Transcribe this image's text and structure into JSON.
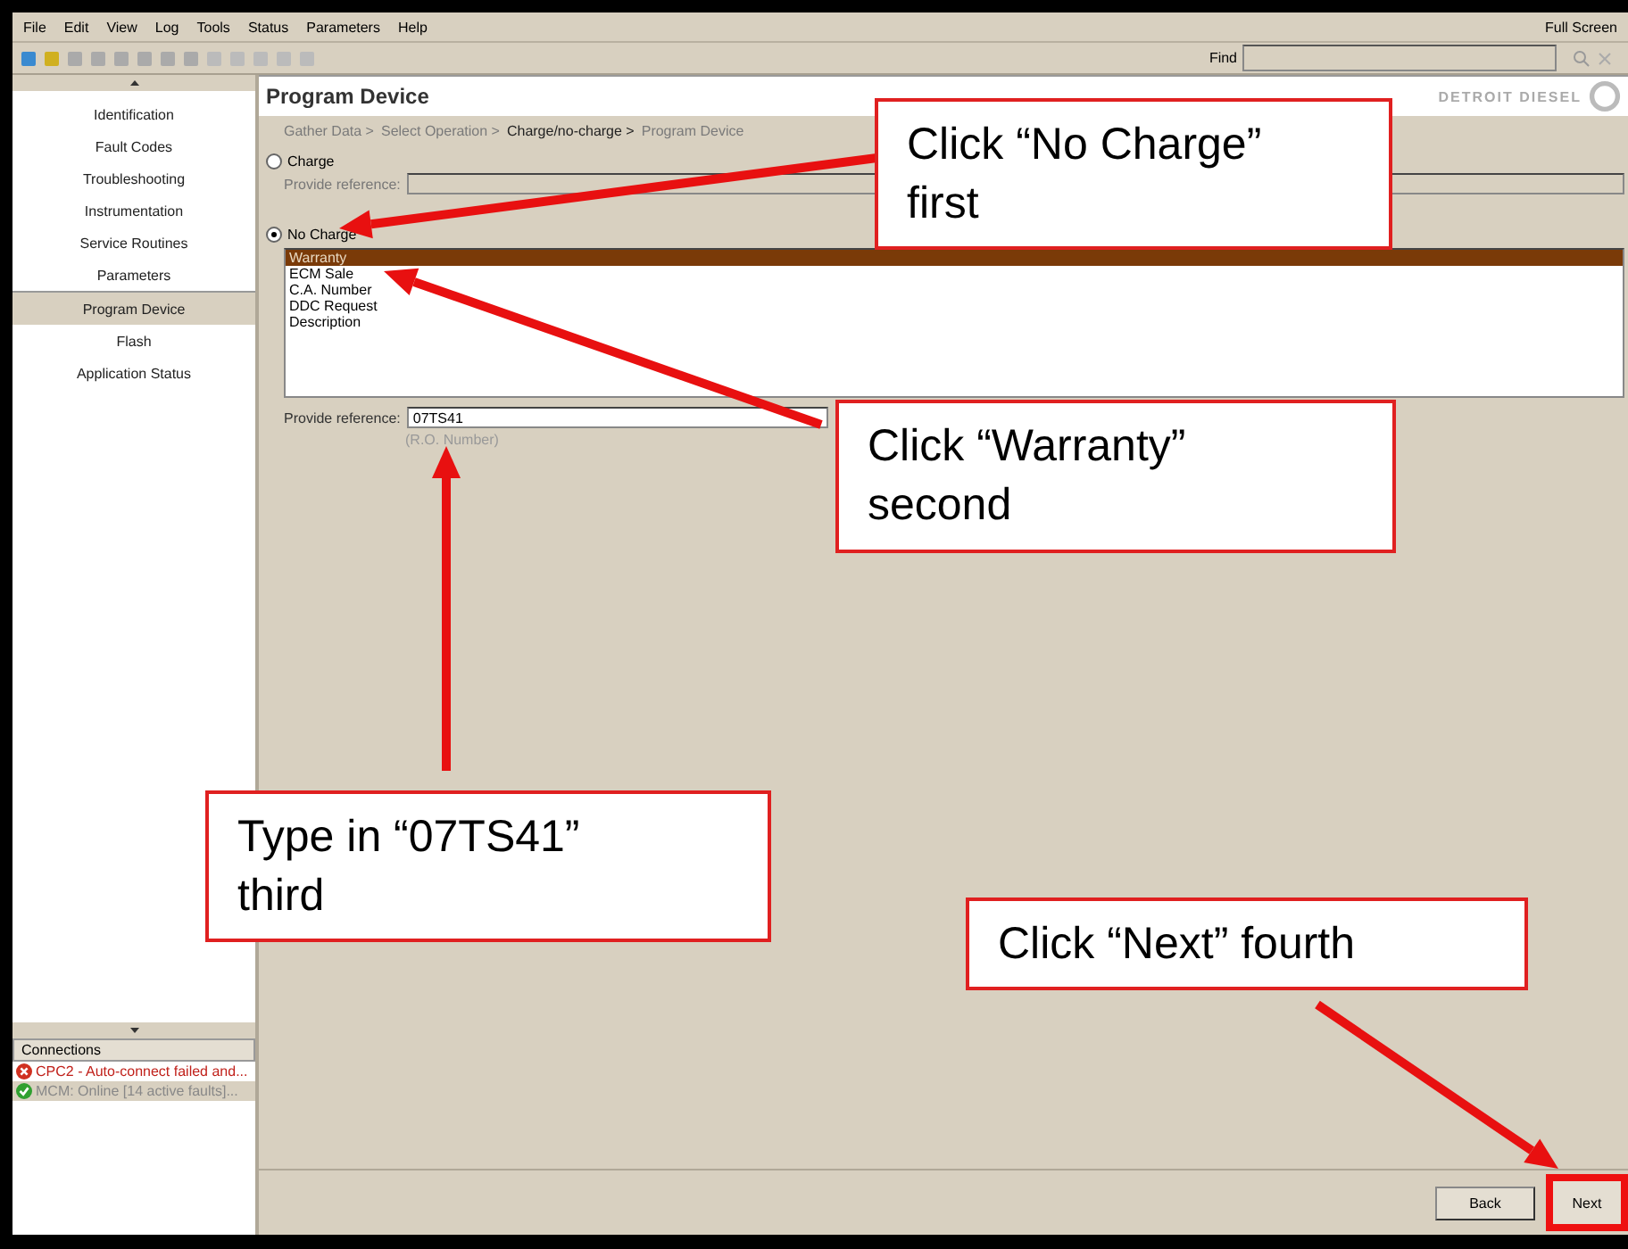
{
  "menu": [
    "File",
    "Edit",
    "View",
    "Log",
    "Tools",
    "Status",
    "Parameters",
    "Help"
  ],
  "full_screen": "Full Screen",
  "find": {
    "label": "Find"
  },
  "logo": "DETROIT DIESEL",
  "sidebar": {
    "items": [
      {
        "label": "Identification",
        "selected": false
      },
      {
        "label": "Fault Codes",
        "selected": false
      },
      {
        "label": "Troubleshooting",
        "selected": false
      },
      {
        "label": "Instrumentation",
        "selected": false
      },
      {
        "label": "Service Routines",
        "selected": false
      },
      {
        "label": "Parameters",
        "selected": false
      },
      {
        "label": "Program Device",
        "selected": true
      },
      {
        "label": "Flash",
        "selected": false
      },
      {
        "label": "Application Status",
        "selected": false
      }
    ]
  },
  "connections": {
    "title": "Connections",
    "items": [
      {
        "kind": "error",
        "text": "CPC2 - Auto-connect failed and...",
        "selected": false
      },
      {
        "kind": "ok",
        "text": "MCM: Online [14 active faults]...",
        "selected": true
      }
    ]
  },
  "page_title": "Program Device",
  "breadcrumb": [
    {
      "label": "Gather Data >",
      "current": false
    },
    {
      "label": "Select Operation >",
      "current": false
    },
    {
      "label": "Charge/no-charge >",
      "current": true
    },
    {
      "label": "Program Device",
      "current": false
    }
  ],
  "options": [
    {
      "label": "Charge",
      "selected": false,
      "reference_label": "Provide reference:"
    },
    {
      "label": "No Charge",
      "selected": true
    }
  ],
  "reasons": [
    {
      "label": "Warranty",
      "selected": true
    },
    {
      "label": "ECM Sale",
      "selected": false
    },
    {
      "label": "C.A. Number",
      "selected": false
    },
    {
      "label": "DDC Request",
      "selected": false
    },
    {
      "label": "Description",
      "selected": false
    }
  ],
  "reference": {
    "label": "Provide reference:",
    "value": "07TS41",
    "hint": "(R.O. Number)"
  },
  "buttons": [
    {
      "label": "Back",
      "highlighted": false
    },
    {
      "label": "Next",
      "highlighted": true
    }
  ],
  "callouts": [
    "Click “No Charge” first",
    "Click “Warranty” second",
    "Type in “07TS41” third",
    "Click “Next” fourth"
  ]
}
